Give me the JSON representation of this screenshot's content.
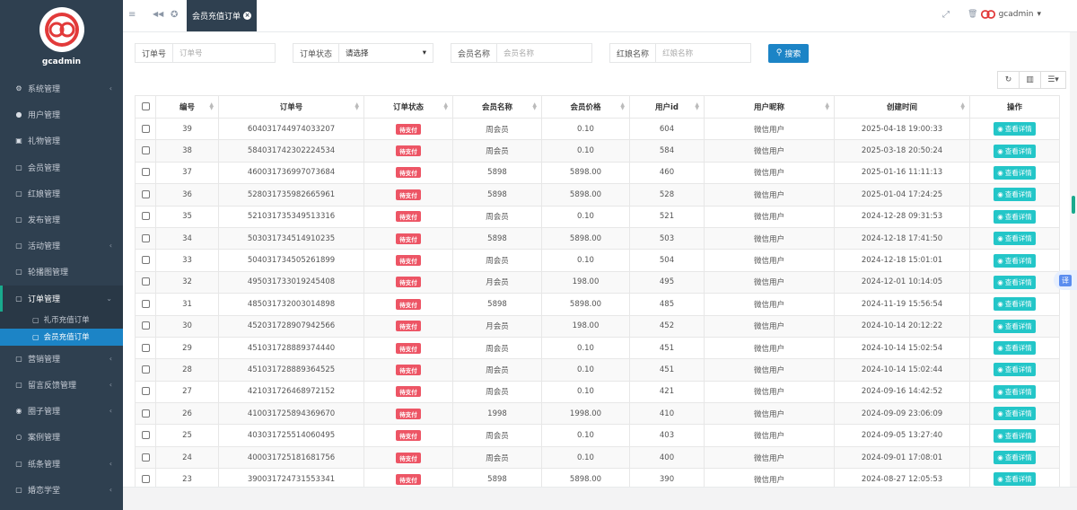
{
  "app": {
    "name": "gcadmin"
  },
  "sidebar": {
    "items": [
      {
        "label": "系统管理",
        "icon": "gears-icon",
        "glyph": "⚙",
        "arrow": true
      },
      {
        "label": "用户管理",
        "icon": "user-icon",
        "glyph": "●",
        "arrow": false
      },
      {
        "label": "礼物管理",
        "icon": "gift-icon",
        "glyph": "▣",
        "arrow": false
      },
      {
        "label": "会员管理",
        "icon": "copy-icon",
        "glyph": "▢",
        "arrow": false
      },
      {
        "label": "红娘管理",
        "icon": "copy-icon",
        "glyph": "▢",
        "arrow": false
      },
      {
        "label": "发布管理",
        "icon": "copy-icon",
        "glyph": "▢",
        "arrow": false
      },
      {
        "label": "活动管理",
        "icon": "copy-icon",
        "glyph": "▢",
        "arrow": true
      },
      {
        "label": "轮播图管理",
        "icon": "copy-icon",
        "glyph": "▢",
        "arrow": false
      },
      {
        "label": "订单管理",
        "icon": "copy-icon",
        "glyph": "▢",
        "arrow": true,
        "active": true,
        "children": [
          {
            "label": "礼币充值订单",
            "icon": "copy-icon",
            "glyph": "▢"
          },
          {
            "label": "会员充值订单",
            "icon": "copy-icon",
            "glyph": "▢",
            "active": true
          }
        ]
      },
      {
        "label": "营销管理",
        "icon": "copy-icon",
        "glyph": "▢",
        "arrow": true
      },
      {
        "label": "留言反馈管理",
        "icon": "copy-icon",
        "glyph": "▢",
        "arrow": true
      },
      {
        "label": "圈子管理",
        "icon": "globe-icon",
        "glyph": "◉",
        "arrow": true
      },
      {
        "label": "案例管理",
        "icon": "circle-icon",
        "glyph": "○",
        "arrow": false
      },
      {
        "label": "纸条管理",
        "icon": "copy-icon",
        "glyph": "▢",
        "arrow": true
      },
      {
        "label": "婚恋学堂",
        "icon": "copy-icon",
        "glyph": "▢",
        "arrow": true
      }
    ]
  },
  "topbar": {
    "menu_glyph": "≡",
    "back_glyph": "◀◀",
    "home_glyph": "✪",
    "active_tab": "会员充值订单",
    "tab_close": "×",
    "fullscreen_glyph": "⤢",
    "trash_glyph": "🗑",
    "user": "gcadmin",
    "caret": "▾"
  },
  "search": {
    "order_no": {
      "label": "订单号",
      "placeholder": "订单号"
    },
    "order_status": {
      "label": "订单状态",
      "value": "请选择"
    },
    "member_name": {
      "label": "会员名称",
      "placeholder": "会员名称"
    },
    "matchmaker_name": {
      "label": "红娘名称",
      "placeholder": "红娘名称"
    },
    "search_label": "搜索"
  },
  "toolbar": {
    "refresh": "↻",
    "columns": "▥",
    "export": "☰▾"
  },
  "table": {
    "headers": [
      "编号",
      "订单号",
      "订单状态",
      "会员名称",
      "会员价格",
      "用户id",
      "用户昵称",
      "创建时间",
      "操作"
    ],
    "action_label": "查看详情",
    "status_label": "待支付",
    "rows": [
      [
        "39",
        "604031744974033207",
        "待支付",
        "周会员",
        "0.10",
        "604",
        "微信用户",
        "2025-04-18 19:00:33"
      ],
      [
        "38",
        "584031742302224534",
        "待支付",
        "周会员",
        "0.10",
        "584",
        "微信用户",
        "2025-03-18 20:50:24"
      ],
      [
        "37",
        "460031736997073684",
        "待支付",
        "5898",
        "5898.00",
        "460",
        "微信用户",
        "2025-01-16 11:11:13"
      ],
      [
        "36",
        "528031735982665961",
        "待支付",
        "5898",
        "5898.00",
        "528",
        "微信用户",
        "2025-01-04 17:24:25"
      ],
      [
        "35",
        "521031735349513316",
        "待支付",
        "周会员",
        "0.10",
        "521",
        "微信用户",
        "2024-12-28 09:31:53"
      ],
      [
        "34",
        "503031734514910235",
        "待支付",
        "5898",
        "5898.00",
        "503",
        "微信用户",
        "2024-12-18 17:41:50"
      ],
      [
        "33",
        "504031734505261899",
        "待支付",
        "周会员",
        "0.10",
        "504",
        "微信用户",
        "2024-12-18 15:01:01"
      ],
      [
        "32",
        "495031733019245408",
        "待支付",
        "月会员",
        "198.00",
        "495",
        "微信用户",
        "2024-12-01 10:14:05"
      ],
      [
        "31",
        "485031732003014898",
        "待支付",
        "5898",
        "5898.00",
        "485",
        "微信用户",
        "2024-11-19 15:56:54"
      ],
      [
        "30",
        "452031728907942566",
        "待支付",
        "月会员",
        "198.00",
        "452",
        "微信用户",
        "2024-10-14 20:12:22"
      ],
      [
        "29",
        "451031728889374440",
        "待支付",
        "周会员",
        "0.10",
        "451",
        "微信用户",
        "2024-10-14 15:02:54"
      ],
      [
        "28",
        "451031728889364525",
        "待支付",
        "周会员",
        "0.10",
        "451",
        "微信用户",
        "2024-10-14 15:02:44"
      ],
      [
        "27",
        "421031726468972152",
        "待支付",
        "周会员",
        "0.10",
        "421",
        "微信用户",
        "2024-09-16 14:42:52"
      ],
      [
        "26",
        "410031725894369670",
        "待支付",
        "1998",
        "1998.00",
        "410",
        "微信用户",
        "2024-09-09 23:06:09"
      ],
      [
        "25",
        "403031725514060495",
        "待支付",
        "周会员",
        "0.10",
        "403",
        "微信用户",
        "2024-09-05 13:27:40"
      ],
      [
        "24",
        "400031725181681756",
        "待支付",
        "周会员",
        "0.10",
        "400",
        "微信用户",
        "2024-09-01 17:08:01"
      ],
      [
        "23",
        "390031724731553341",
        "待支付",
        "5898",
        "5898.00",
        "390",
        "微信用户",
        "2024-08-27 12:05:53"
      ]
    ]
  },
  "translate": {
    "label": "译"
  },
  "colors": {
    "sidebar": "#2f4050",
    "primary": "#1c84c6",
    "danger": "#ed5565",
    "info": "#23c6c8",
    "accent": "#19aa8d"
  }
}
